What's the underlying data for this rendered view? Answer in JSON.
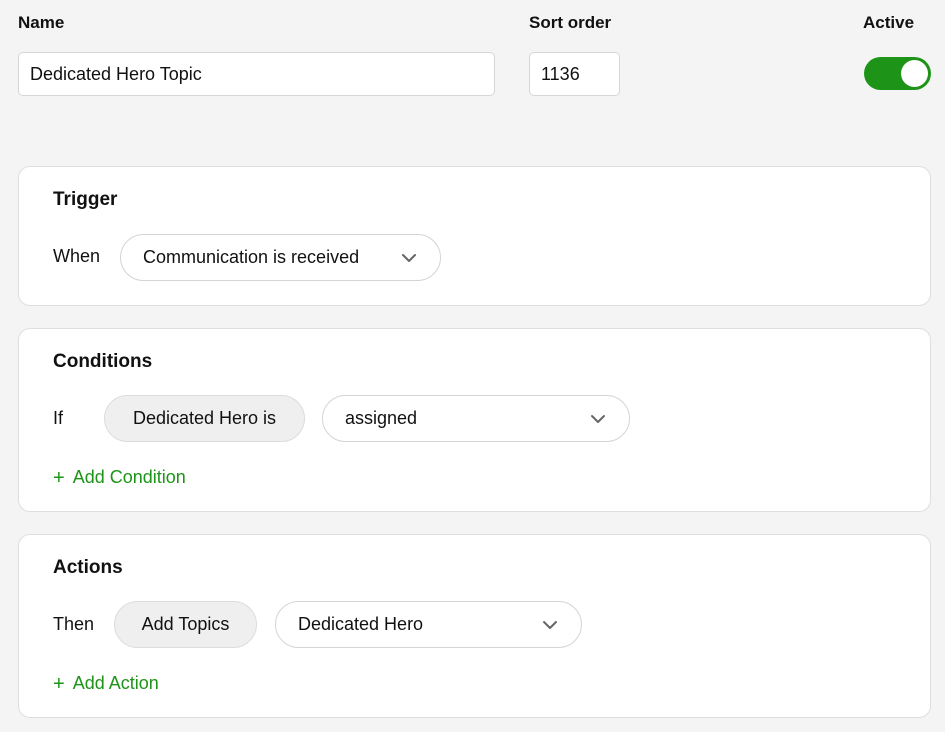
{
  "header": {
    "name_label": "Name",
    "name_value": "Dedicated Hero Topic",
    "sort_label": "Sort order",
    "sort_value": "1136",
    "active_label": "Active",
    "active_on": true
  },
  "trigger": {
    "title": "Trigger",
    "when_label": "When",
    "event_value": "Communication is received"
  },
  "conditions": {
    "title": "Conditions",
    "if_label": "If",
    "field": "Dedicated Hero is",
    "value": "assigned",
    "add_label": "Add Condition"
  },
  "actions": {
    "title": "Actions",
    "then_label": "Then",
    "action": "Add Topics",
    "value": "Dedicated Hero",
    "add_label": "Add Action"
  },
  "colors": {
    "accent": "#1d9417",
    "background": "#f4f4f4"
  },
  "icons": [
    "chevron-down-icon",
    "plus-icon"
  ]
}
